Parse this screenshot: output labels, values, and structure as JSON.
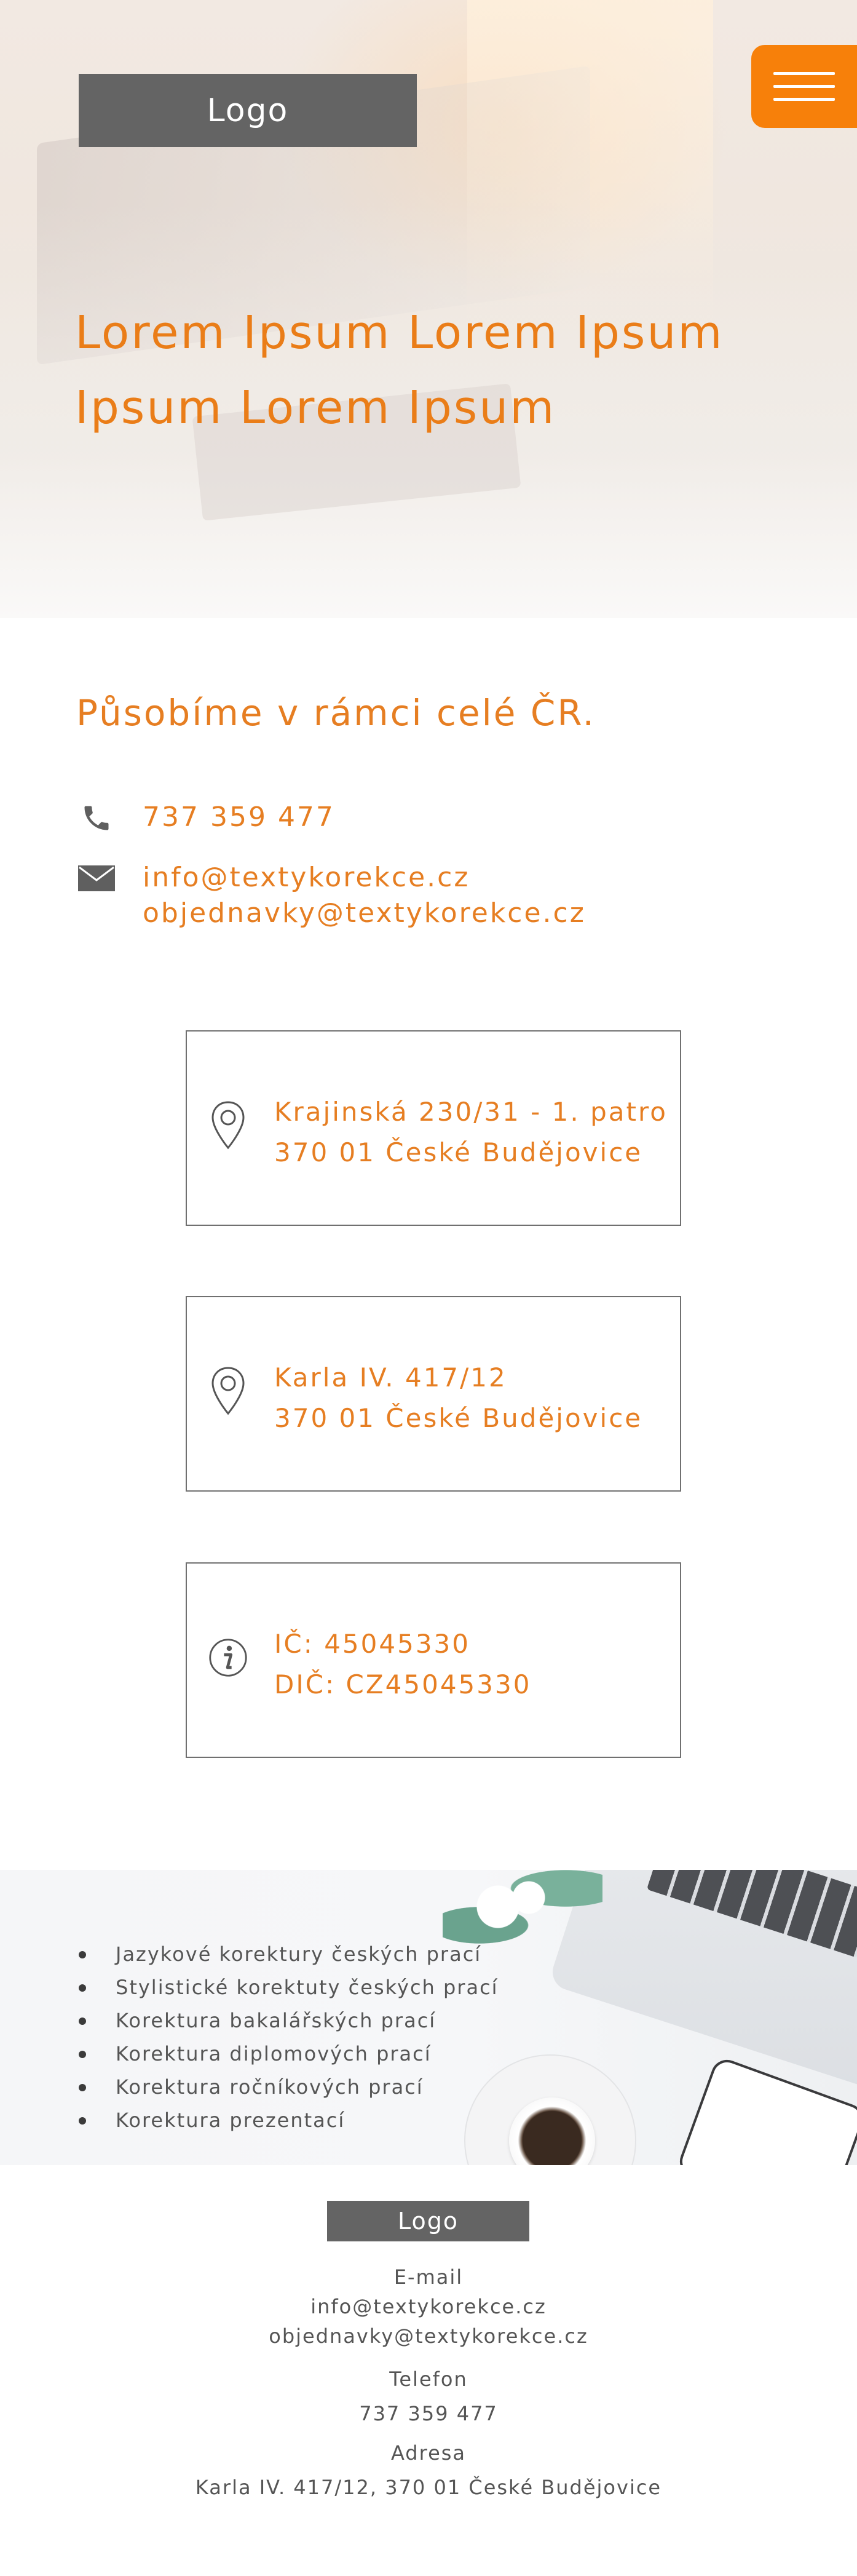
{
  "header": {
    "logo": "Logo",
    "title_line1": "Lorem Ipsum Lorem Ipsum",
    "title_line2": "Ipsum Lorem Ipsum"
  },
  "contact": {
    "heading": "Působíme v rámci celé ČR.",
    "phone": "737 359 477",
    "email_primary": "info@textykorekce.cz",
    "email_orders": "objednavky@textykorekce.cz"
  },
  "cards": [
    {
      "icon": "location-pin-icon",
      "line1": "Krajinská 230/31 - 1. patro",
      "line2": "370 01 České Budějovice"
    },
    {
      "icon": "location-pin-icon",
      "line1": "Karla IV. 417/12",
      "line2": "370 01 České Budějovice"
    },
    {
      "icon": "info-icon",
      "line1": "IČ: 45045330",
      "line2": "DIČ: CZ45045330"
    }
  ],
  "services": [
    "Jazykové korektury českých prací",
    "Stylistické korektuty českých prací",
    "Korektura bakalářských prací",
    "Korektura diplomových prací",
    "Korektura ročníkových prací",
    "Korektura prezentací"
  ],
  "footer": {
    "logo": "Logo",
    "email_label": "E-mail",
    "email_primary": "info@textykorekce.cz",
    "email_orders": "objednavky@textykorekce.cz",
    "phone_label": "Telefon",
    "phone": "737 359 477",
    "address_label": "Adresa",
    "address": "Karla IV. 417/12, 370 01 České Budějovice"
  },
  "colors": {
    "accent": "#e67e22",
    "menu_button": "#f7800a",
    "logo_bg": "#646464",
    "text_gray": "#555555"
  }
}
